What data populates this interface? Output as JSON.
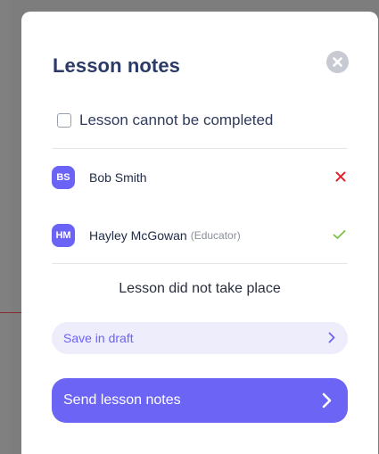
{
  "modal": {
    "title": "Lesson notes",
    "close_icon": "close-circle-icon",
    "cannot_complete_label": "Lesson cannot be completed",
    "participants": [
      {
        "initials": "BS",
        "name": "Bob Smith",
        "role": "",
        "status": "absent",
        "status_icon": "x-mark-icon",
        "status_color": "#e0242b"
      },
      {
        "initials": "HM",
        "name": "Hayley McGowan",
        "role": "(Educator)",
        "status": "present",
        "status_icon": "check-mark-icon",
        "status_color": "#7cc043"
      }
    ],
    "summary": "Lesson did not take place",
    "save_draft_label": "Save in draft",
    "send_label": "Send lesson notes"
  },
  "colors": {
    "accent": "#6c64f4",
    "title": "#2b3a67",
    "draft_bg": "#eeedfc"
  }
}
